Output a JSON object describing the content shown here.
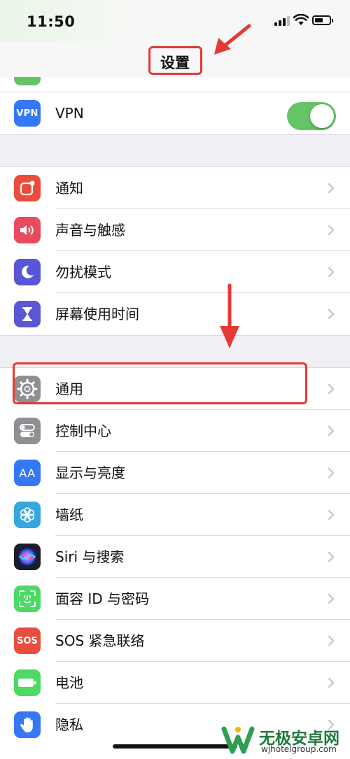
{
  "status_bar": {
    "time": "11:50"
  },
  "nav": {
    "title": "设置"
  },
  "groups": [
    {
      "rows": [
        {
          "label": "VPN",
          "icon": "vpn-icon",
          "icon_text": "VPN",
          "icon_bg": "#3478f6",
          "toggle_on": true
        }
      ]
    },
    {
      "rows": [
        {
          "label": "通知",
          "icon": "notifications-icon",
          "icon_bg": "#eb4d3d"
        },
        {
          "label": "声音与触感",
          "icon": "speaker-icon",
          "icon_bg": "#e94b5e"
        },
        {
          "label": "勿扰模式",
          "icon": "moon-icon",
          "icon_bg": "#5856d6"
        },
        {
          "label": "屏幕使用时间",
          "icon": "hourglass-icon",
          "icon_bg": "#5b56d2"
        }
      ]
    },
    {
      "rows": [
        {
          "label": "通用",
          "icon": "gear-icon",
          "icon_bg": "#8e8e93"
        },
        {
          "label": "控制中心",
          "icon": "control-center-icon",
          "icon_bg": "#8e8e93"
        },
        {
          "label": "显示与亮度",
          "icon": "display-icon",
          "icon_text": "AA",
          "icon_bg": "#3478f6"
        },
        {
          "label": "墙纸",
          "icon": "wallpaper-flower-icon",
          "icon_bg": "#35a7e0"
        },
        {
          "label": "Siri 与搜索",
          "icon": "siri-icon",
          "icon_bg": "#1c1c2e"
        },
        {
          "label": "面容 ID 与密码",
          "icon": "face-id-icon",
          "icon_bg": "#4cd964"
        },
        {
          "label": "SOS 紧急联络",
          "icon": "sos-icon",
          "icon_text": "SOS",
          "icon_bg": "#eb4d3d"
        },
        {
          "label": "电池",
          "icon": "battery-icon",
          "icon_bg": "#4cd964"
        },
        {
          "label": "隐私",
          "icon": "hand-icon",
          "icon_bg": "#3478f6"
        }
      ]
    }
  ],
  "watermark": {
    "title": "无极安卓网",
    "url": "wjhotelgroup.com"
  }
}
